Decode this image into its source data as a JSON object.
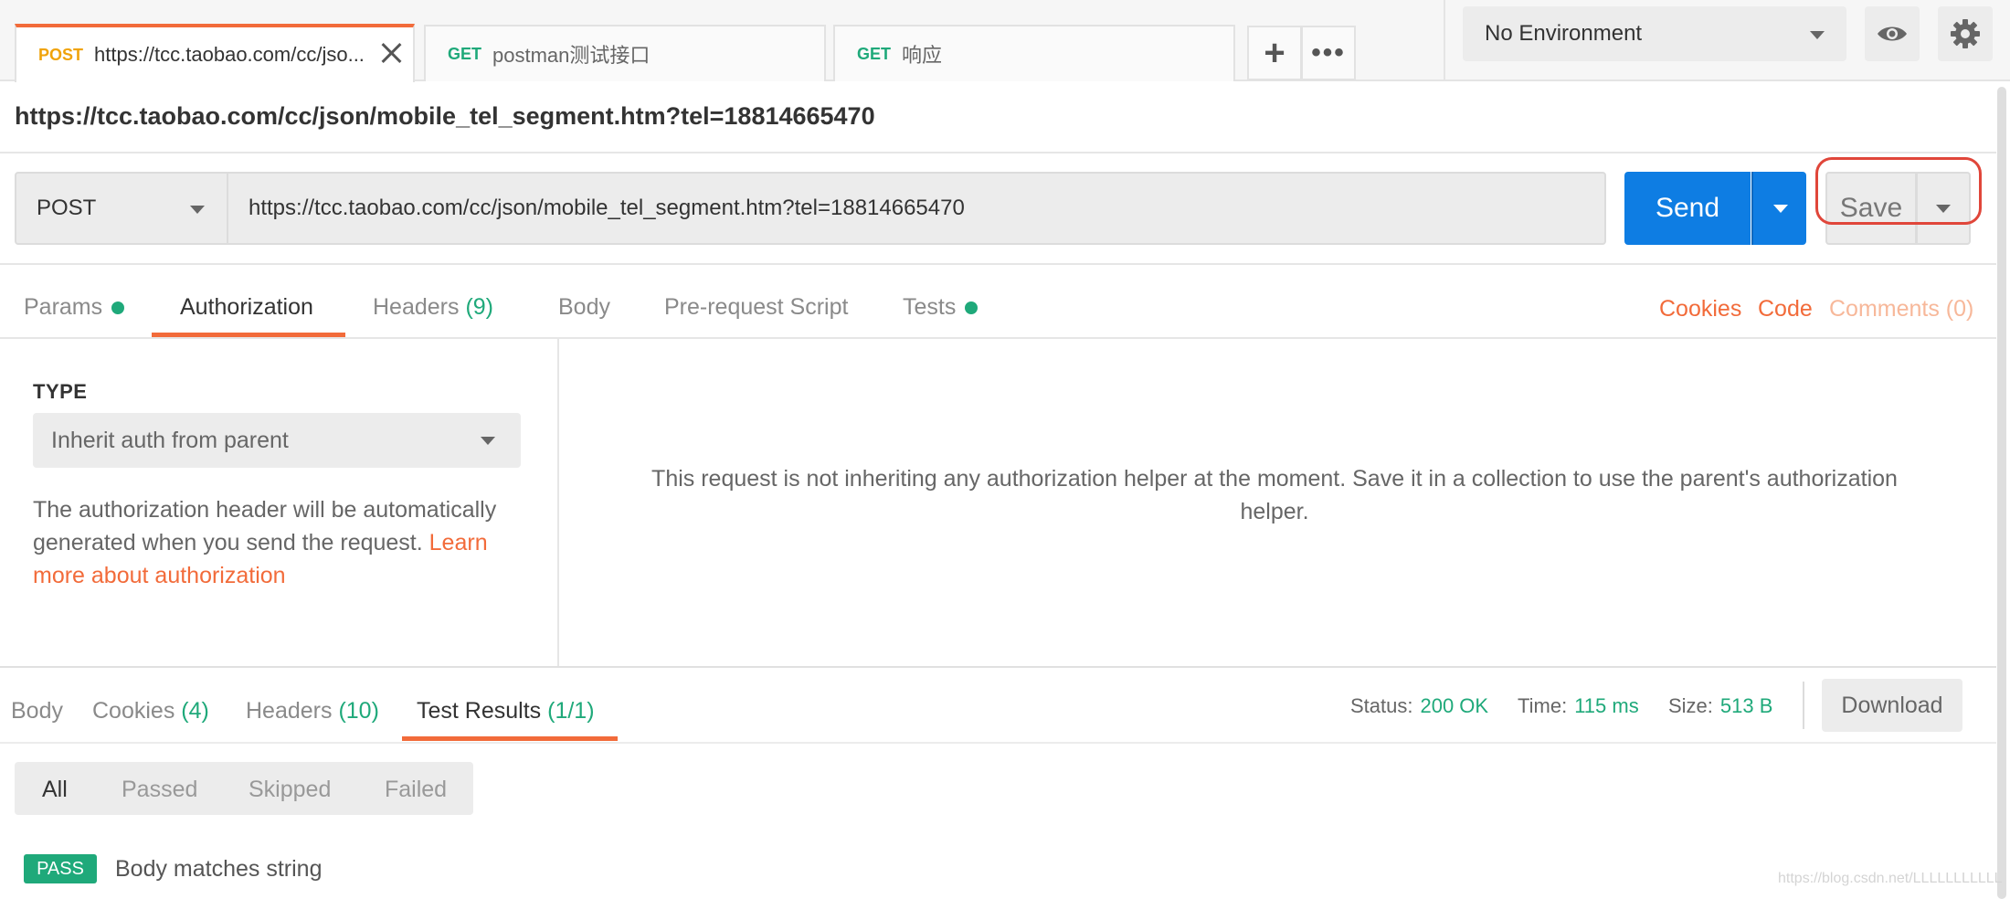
{
  "tabs": [
    {
      "method": "POST",
      "title": "https://tcc.taobao.com/cc/jso..."
    },
    {
      "method": "GET",
      "title": "postman测试接口"
    },
    {
      "method": "GET",
      "title": "响应"
    }
  ],
  "tab_actions": {
    "add_icon": "plus-icon",
    "more_icon": "more-icon"
  },
  "environment": {
    "selected": "No Environment",
    "eye_icon": "eye-icon",
    "settings_icon": "gear-icon"
  },
  "request": {
    "title": "https://tcc.taobao.com/cc/json/mobile_tel_segment.htm?tel=18814665470",
    "method": "POST",
    "url": "https://tcc.taobao.com/cc/json/mobile_tel_segment.htm?tel=18814665470",
    "send_label": "Send",
    "save_label": "Save"
  },
  "request_tabs": {
    "params": "Params",
    "authorization": "Authorization",
    "headers": "Headers",
    "headers_count": "(9)",
    "body": "Body",
    "prerequest": "Pre-request Script",
    "tests": "Tests",
    "cookies": "Cookies",
    "code": "Code",
    "comments": "Comments (0)"
  },
  "auth": {
    "type_label": "TYPE",
    "type_value": "Inherit auth from parent",
    "description": "The authorization header will be automatically generated when you send the request. ",
    "learn_link": "Learn more about authorization",
    "message": "This request is not inheriting any authorization helper at the moment. Save it in a collection to use the parent's authorization helper."
  },
  "response_tabs": {
    "body": "Body",
    "cookies": "Cookies",
    "cookies_count": "(4)",
    "headers": "Headers",
    "headers_count": "(10)",
    "test_results": "Test Results",
    "test_results_count": "(1/1)"
  },
  "response_meta": {
    "status_label": "Status:",
    "status_value": "200 OK",
    "time_label": "Time:",
    "time_value": "115 ms",
    "size_label": "Size:",
    "size_value": "513 B",
    "download_label": "Download"
  },
  "filters": [
    "All",
    "Passed",
    "Skipped",
    "Failed"
  ],
  "test_result": {
    "badge": "PASS",
    "name": "Body matches string"
  },
  "watermark": "https://blog.csdn.net/LLLLLLLLLLL",
  "colors": {
    "accent": "#f26b3a",
    "send_blue": "#0e7de3",
    "success_green": "#1fa97a",
    "highlight_red": "#e0463a"
  }
}
